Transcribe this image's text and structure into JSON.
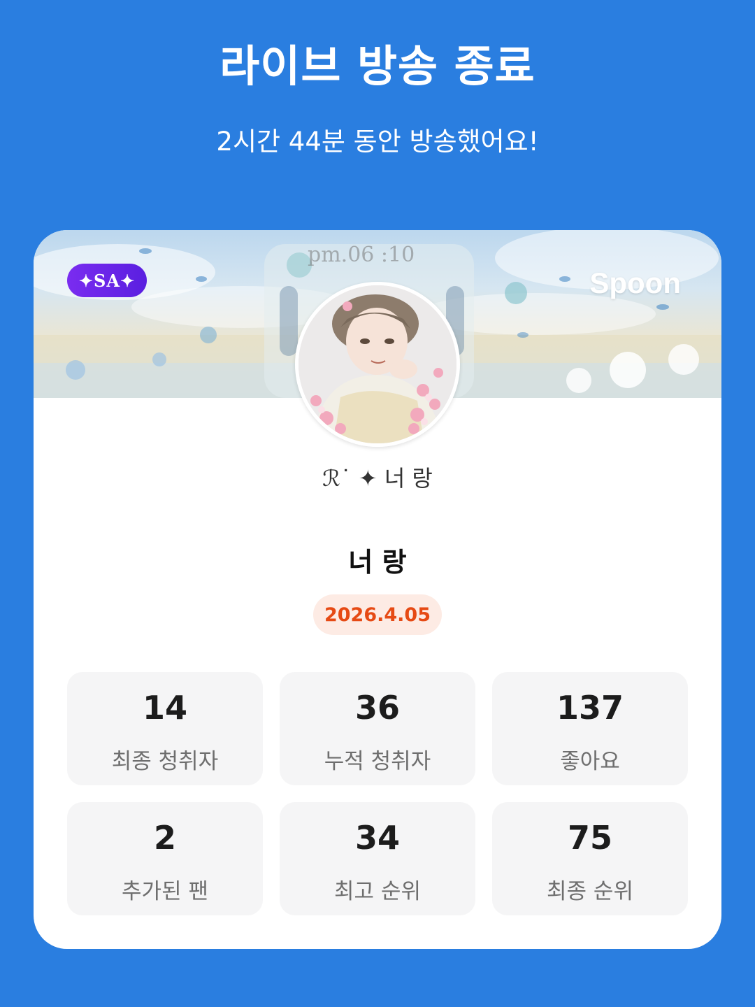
{
  "header": {
    "title": "라이브 방송 종료",
    "subtitle": "2시간 44분 동안 방송했어요!"
  },
  "card": {
    "banner": {
      "badge_text": "✦SA✦",
      "brand": "Spoon",
      "time_text": "pm.06 :10"
    },
    "nickname": "ℛ˙ ✦ 너 랑",
    "live_title": "너 랑",
    "date": "2026.4.05",
    "stats": [
      {
        "value": "14",
        "label": "최종 청취자"
      },
      {
        "value": "36",
        "label": "누적 청취자"
      },
      {
        "value": "137",
        "label": "좋아요"
      },
      {
        "value": "2",
        "label": "추가된 팬"
      },
      {
        "value": "34",
        "label": "최고 순위"
      },
      {
        "value": "75",
        "label": "최종 순위"
      }
    ]
  },
  "colors": {
    "background": "#2a7ee0",
    "date_text": "#e64a14",
    "date_bg": "#fdebe4",
    "badge": "#6a25e8"
  },
  "icons": {
    "avatar": "profile-illustration",
    "badge": "sa-badge-icon"
  }
}
